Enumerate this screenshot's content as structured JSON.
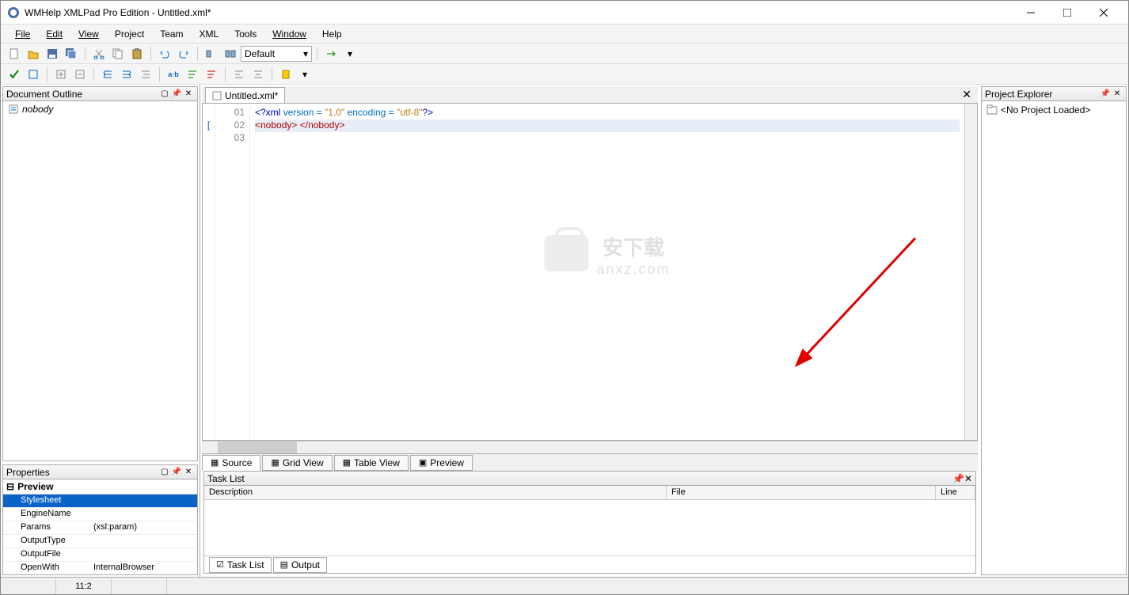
{
  "window": {
    "title": "WMHelp XMLPad Pro Edition - Untitled.xml*"
  },
  "menu": [
    "File",
    "Edit",
    "View",
    "Project",
    "Team",
    "XML",
    "Tools",
    "Window",
    "Help"
  ],
  "toolbar_combo": "Default",
  "outline": {
    "title": "Document Outline",
    "root": "nobody"
  },
  "properties": {
    "title": "Properties",
    "group": "Preview",
    "rows": [
      {
        "name": "Stylesheet",
        "value": ""
      },
      {
        "name": "EngineName",
        "value": ""
      },
      {
        "name": "Params",
        "value": "(xsl:param)"
      },
      {
        "name": "OutputType",
        "value": ""
      },
      {
        "name": "OutputFile",
        "value": ""
      },
      {
        "name": "OpenWith",
        "value": "InternalBrowser"
      }
    ]
  },
  "editor": {
    "tab": "Untitled.xml*",
    "lines": {
      "l1": {
        "num": "01",
        "pi_open": "<?xml ",
        "attr1": "version = ",
        "val1": "\"1.0\"",
        "attr2": " encoding = ",
        "val2": "\"utf-8\"",
        "pi_close": "?>"
      },
      "l2": {
        "num": "02",
        "open": "<nobody>",
        "space": " ",
        "close": "</nobody>"
      },
      "l3": {
        "num": "03"
      }
    }
  },
  "view_tabs": [
    "Source",
    "Grid View",
    "Table View",
    "Preview"
  ],
  "project_explorer": {
    "title": "Project Explorer",
    "empty": "<No Project Loaded>"
  },
  "tasklist": {
    "title": "Task List",
    "cols": {
      "desc": "Description",
      "file": "File",
      "line": "Line"
    },
    "tabs": [
      "Task List",
      "Output"
    ]
  },
  "status": {
    "pos": "11:2"
  },
  "watermark": {
    "t1": "安下载",
    "t2": "anxz.com"
  }
}
